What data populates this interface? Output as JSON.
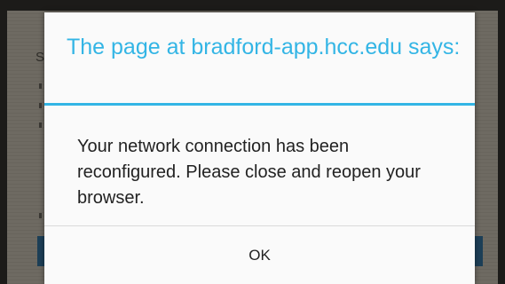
{
  "background": {
    "partial_letter": "S"
  },
  "dialog": {
    "title": "The page at bradford-app.hcc.edu says:",
    "message": "Your network connection has been reconfigured. Please close and reopen your browser.",
    "ok_label": "OK",
    "accent_color": "#33b5e5"
  }
}
